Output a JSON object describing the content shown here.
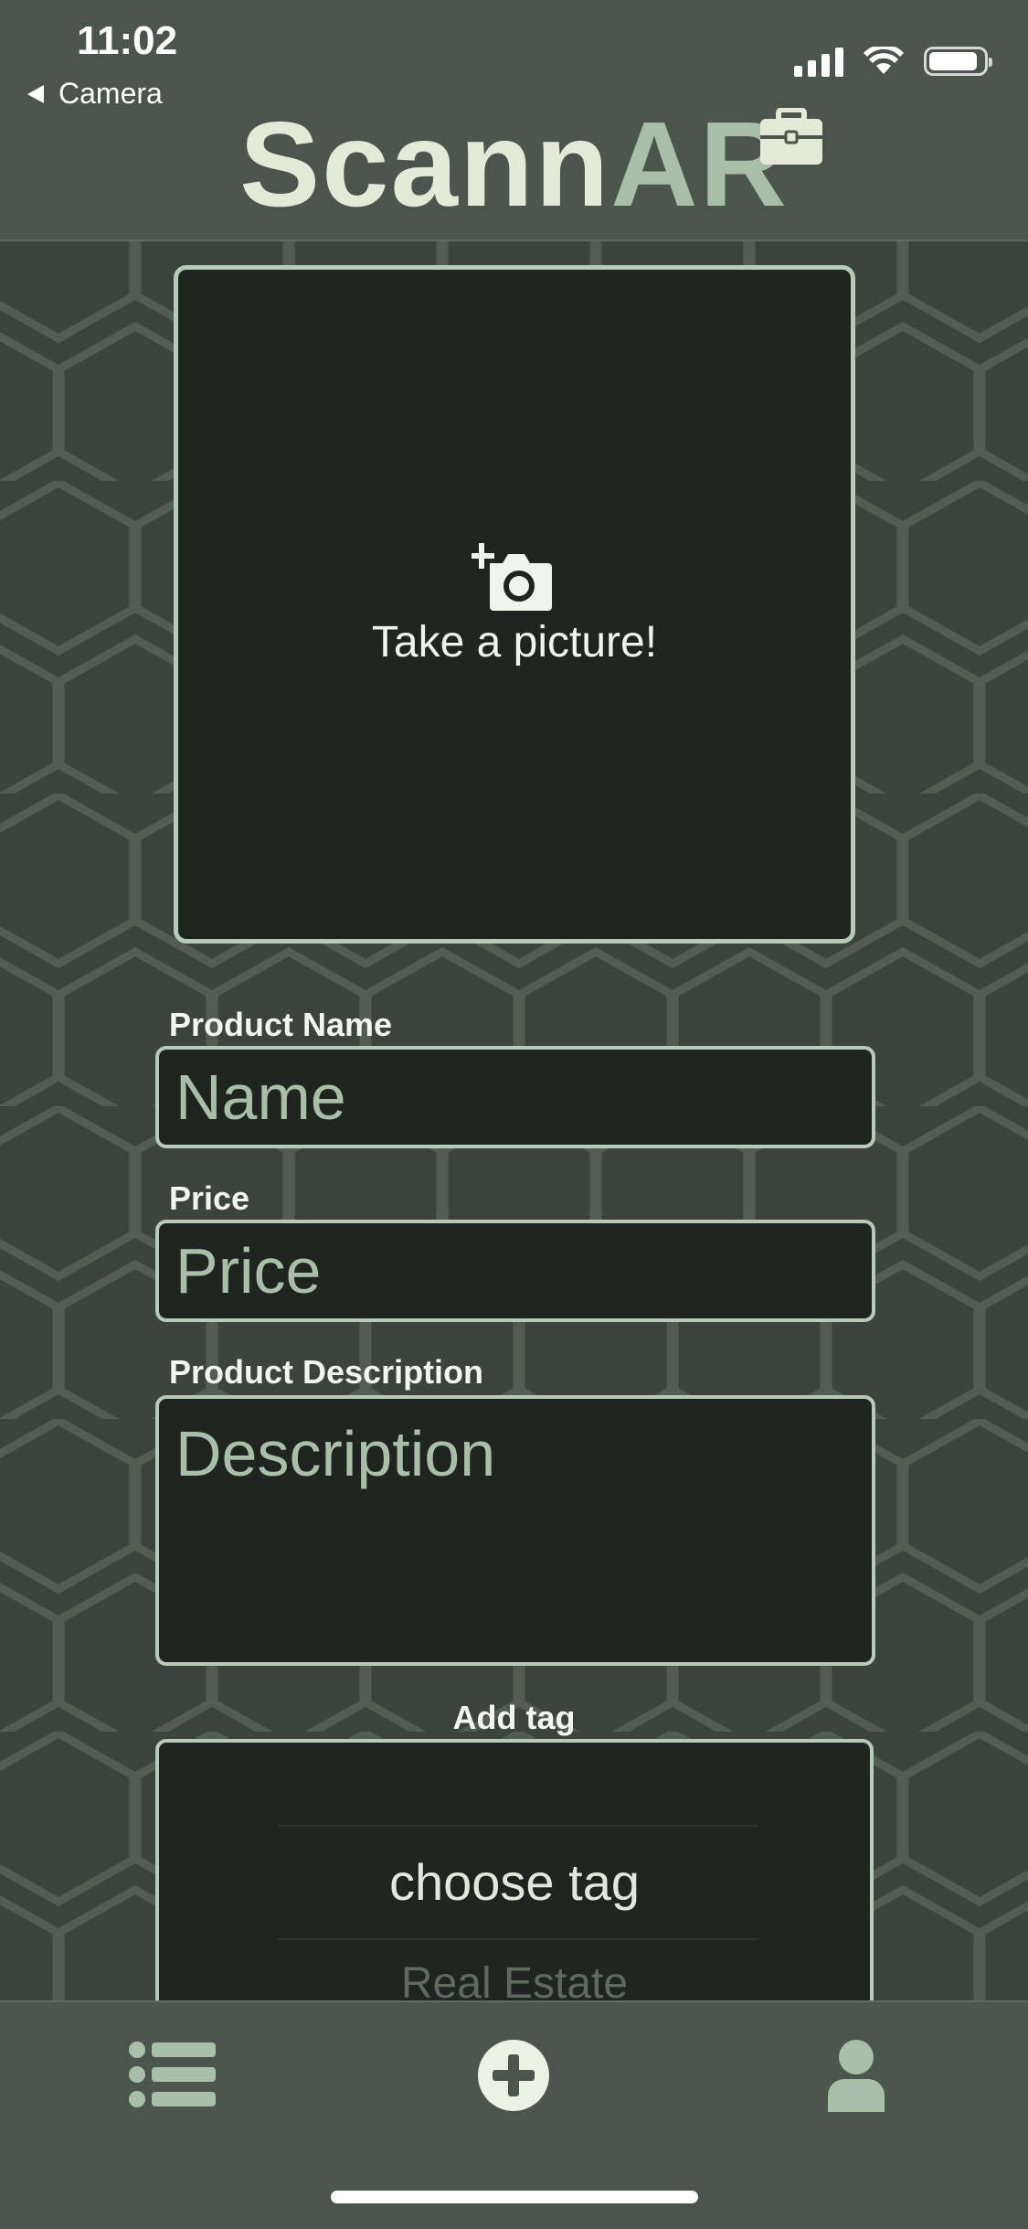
{
  "status_bar": {
    "time": "11:02",
    "back_label": "Camera"
  },
  "header": {
    "logo_part1": "Scann",
    "logo_part2": "AR"
  },
  "photo": {
    "prompt": "Take a picture!"
  },
  "form": {
    "name_label": "Product Name",
    "name_placeholder": "Name",
    "price_label": "Price",
    "price_placeholder": "Price",
    "description_label": "Product Description",
    "description_placeholder": "Description",
    "tag_label": "Add tag",
    "tag_selected": "choose tag",
    "tag_next": "Real Estate"
  },
  "tabbar": {
    "icons": [
      "list-icon",
      "add-circle-icon",
      "profile-icon"
    ]
  },
  "colors": {
    "background": "#3c433c",
    "bar": "#4c554d",
    "field_bg": "#1f2420",
    "border": "#b8cab8",
    "accent": "#a9bfa9"
  }
}
